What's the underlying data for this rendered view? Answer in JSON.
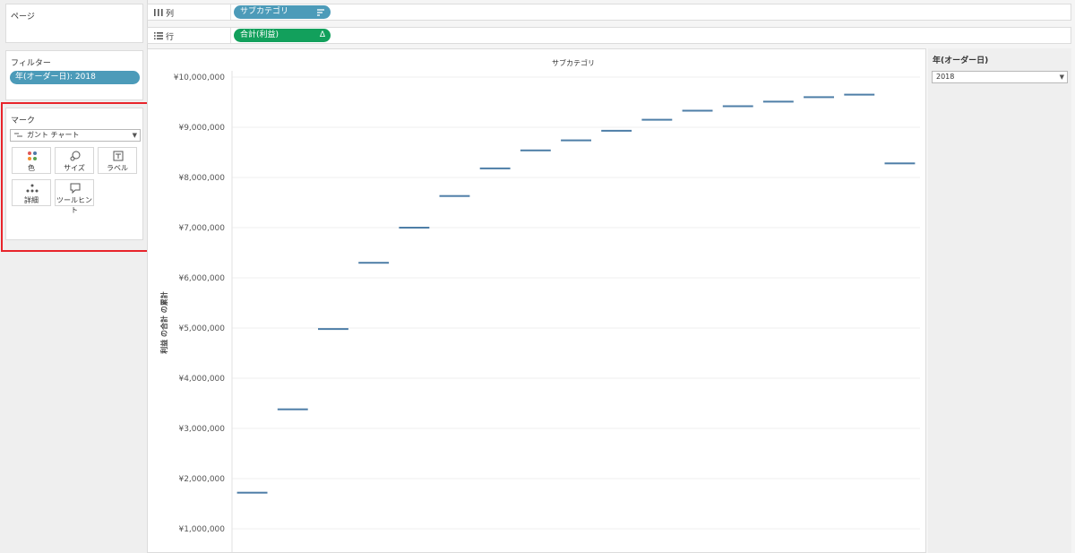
{
  "pages": {
    "title": "ページ"
  },
  "filters": {
    "title": "フィルター",
    "pill": "年(オーダー日): 2018"
  },
  "marks": {
    "title": "マーク",
    "type_label": "ガント チャート",
    "buttons": [
      {
        "label": "色",
        "icon": "color-dots-icon"
      },
      {
        "label": "サイズ",
        "icon": "size-icon"
      },
      {
        "label": "ラベル",
        "icon": "label-icon"
      },
      {
        "label": "詳細",
        "icon": "detail-icon"
      },
      {
        "label": "ツールヒント",
        "icon": "tooltip-icon"
      }
    ]
  },
  "columns_shelf": {
    "label": "列",
    "pill": "サブカテゴリ",
    "pill_icon": "sort-descending-icon"
  },
  "rows_shelf": {
    "label": "行",
    "pill": "合計(利益)",
    "pill_icon": "delta-icon"
  },
  "right_panel": {
    "title": "年(オーダー日)",
    "selected": "2018"
  },
  "colors": {
    "pill_blue": "#4c9bb9",
    "pill_green": "#12a05c",
    "gantt_bar": "#4e7ea7",
    "highlight": "#e8242b"
  },
  "chart_data": {
    "type": "gantt",
    "header": "サブカテゴリ",
    "ylabel": "利益 の合計 の累計",
    "ylim": [
      0,
      10000000
    ],
    "ytick_labels": [
      "¥1,000,000",
      "¥2,000,000",
      "¥3,000,000",
      "¥4,000,000",
      "¥5,000,000",
      "¥6,000,000",
      "¥7,000,000",
      "¥8,000,000",
      "¥9,000,000",
      "¥10,000,000"
    ],
    "ytick_values": [
      1000000,
      2000000,
      3000000,
      4000000,
      5000000,
      6000000,
      7000000,
      8000000,
      9000000,
      10000000
    ],
    "values": [
      1720000,
      3380000,
      4980000,
      6300000,
      7000000,
      7630000,
      8180000,
      8540000,
      8740000,
      8930000,
      9150000,
      9330000,
      9420000,
      9510000,
      9600000,
      9650000,
      8280000
    ]
  }
}
